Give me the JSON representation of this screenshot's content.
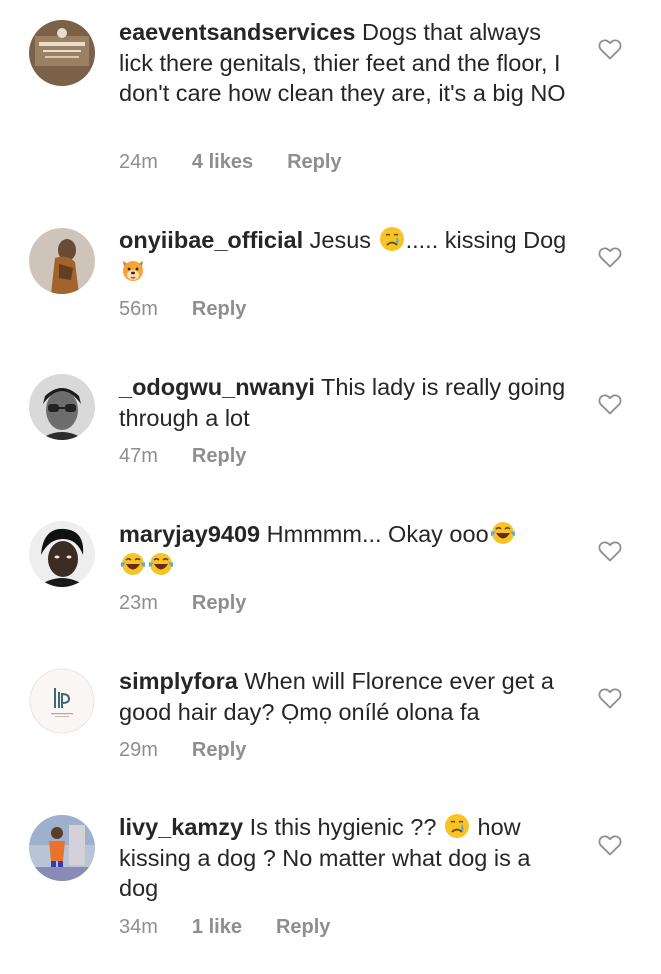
{
  "comments": [
    {
      "username": "eaeventsandservices",
      "body": " Dogs that always lick there genitals, thier feet and the floor, I don't care how clean they are, it's a big NO",
      "time": "24m",
      "likes": "4 likes",
      "reply": "Reply"
    },
    {
      "username": "onyiibae_official",
      "body_before": " Jesus ",
      "emoji_1": "crying-face",
      "body_after": "..... kissing Dog ",
      "emoji_2": "dog-face",
      "time": "56m",
      "reply": "Reply"
    },
    {
      "username": "_odogwu_nwanyi",
      "body": " This lady is really going through a lot",
      "time": "47m",
      "reply": "Reply"
    },
    {
      "username": "maryjay9409",
      "body": " Hmmmm... Okay ooo",
      "emoji": "face-with-tears-of-joy",
      "time": "23m",
      "reply": "Reply"
    },
    {
      "username": "simplyfora",
      "body": " When will Florence ever get a good hair day? Ọmọ onílé olona fa",
      "time": "29m",
      "reply": "Reply"
    },
    {
      "username": "livy_kamzy",
      "body_before": " Is this hygienic ?? ",
      "emoji": "crying-face",
      "body_after": " how kissing a dog ? No matter what dog is a dog",
      "time": "34m",
      "likes": "1 like",
      "reply": "Reply"
    }
  ],
  "colors": {
    "text": "#262626",
    "meta": "#8e8e8e",
    "heart": "#8e8e8e",
    "emoji_yellow": "#f7c325",
    "emoji_tear": "#5aa7e8"
  },
  "icons": {
    "like": "heart-outline-icon"
  }
}
